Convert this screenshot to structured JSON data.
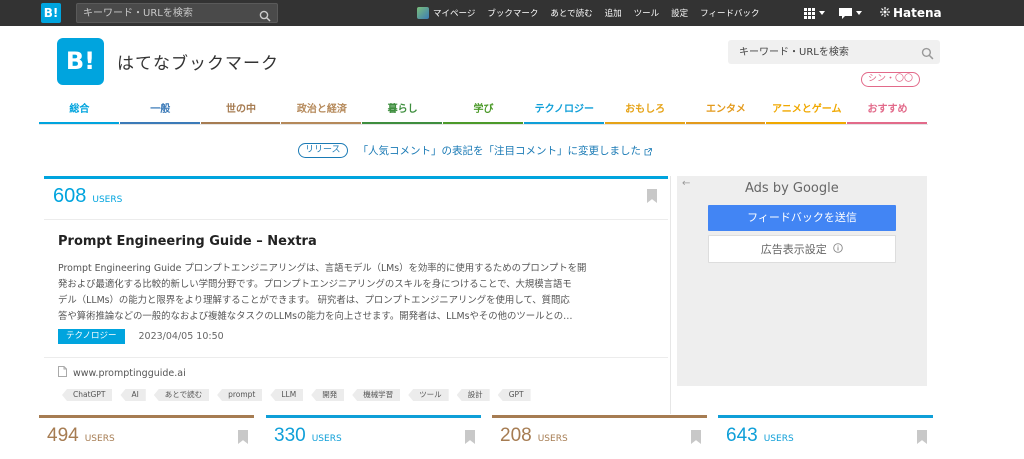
{
  "global_bar": {
    "logo": "B!",
    "search_placeholder": "キーワード・URLを検索",
    "nav": [
      "マイページ",
      "ブックマーク",
      "あとで読む",
      "追加",
      "ツール",
      "設定",
      "フィードバック"
    ],
    "brand": "Hatena"
  },
  "header": {
    "logo": "B!",
    "site_title": "はてなブックマーク",
    "search_placeholder": "キーワード・URLを検索"
  },
  "categories": [
    {
      "label": "総合",
      "color": "#00a4de"
    },
    {
      "label": "一般",
      "color": "#3b7ab8"
    },
    {
      "label": "世の中",
      "color": "#a67c52"
    },
    {
      "label": "政治と経済",
      "color": "#b5895a"
    },
    {
      "label": "暮らし",
      "color": "#3e8e3e"
    },
    {
      "label": "学び",
      "color": "#4c9a2a"
    },
    {
      "label": "テクノロジー",
      "color": "#0f9fd8"
    },
    {
      "label": "おもしろ",
      "color": "#e6a317"
    },
    {
      "label": "エンタメ",
      "color": "#e39a1c"
    },
    {
      "label": "アニメとゲーム",
      "color": "#f0a800"
    },
    {
      "label": "おすすめ",
      "color": "#e26a8a"
    }
  ],
  "recommend_pill": "シン・〇〇",
  "notice": {
    "tag": "リリース",
    "text": "「人気コメント」の表記を「注目コメント」に変更しました"
  },
  "entry": {
    "users": "608",
    "users_label": "USERS",
    "title": "Prompt Engineering Guide – Nextra",
    "summary_lines": [
      "Prompt Engineering Guide プロンプトエンジニアリングは、言語モデル（LMs）を効率的に使用するためのプロンプトを開",
      "発および最適化する比較的新しい学問分野です。プロンプトエンジニアリングのスキルを身につけることで、大規模言語モ",
      "デル（LLMs）の能力と限界をより理解することができます。 研究者は、プロンプトエンジニアリングを使用して、質問応",
      "答や算術推論などの一般的なおよび複雑なタスクのLLMsの能力を向上させます。開発者は、LLMsやその他のツールとの…"
    ],
    "category": "テクノロジー",
    "datetime": "2023/04/05 10:50",
    "domain": "www.promptingguide.ai",
    "tags": [
      "ChatGPT",
      "AI",
      "あとで読む",
      "prompt",
      "LLM",
      "開発",
      "機械学習",
      "ツール",
      "設計",
      "GPT"
    ]
  },
  "ad": {
    "back": "←",
    "label": "Ads by Google",
    "feedback_button": "フィードバックを送信",
    "settings_button": "広告表示設定"
  },
  "mini_cards": [
    {
      "users": "494",
      "label": "USERS",
      "color": "#a67c52"
    },
    {
      "users": "330",
      "label": "USERS",
      "color": "#0f9fd8"
    },
    {
      "users": "208",
      "label": "USERS",
      "color": "#a67c52"
    },
    {
      "users": "643",
      "label": "USERS",
      "color": "#0f9fd8"
    }
  ]
}
